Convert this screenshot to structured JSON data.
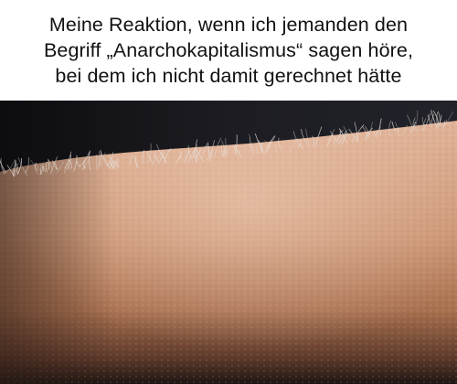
{
  "caption": {
    "text": "Meine Reaktion, wenn ich jemanden den\nBegriff „Anarchokapitalismus“ sagen höre,\nbei dem ich nicht damit gerechnet hätte"
  },
  "photo": {
    "subject_icon": "goosebumps-arm-photo",
    "colors": {
      "background": "#1c1c20",
      "skin_light": "#d9a98b",
      "skin_mid": "#c08a6c",
      "skin_dark": "#6e4636",
      "hair": "#e8e4df"
    }
  }
}
